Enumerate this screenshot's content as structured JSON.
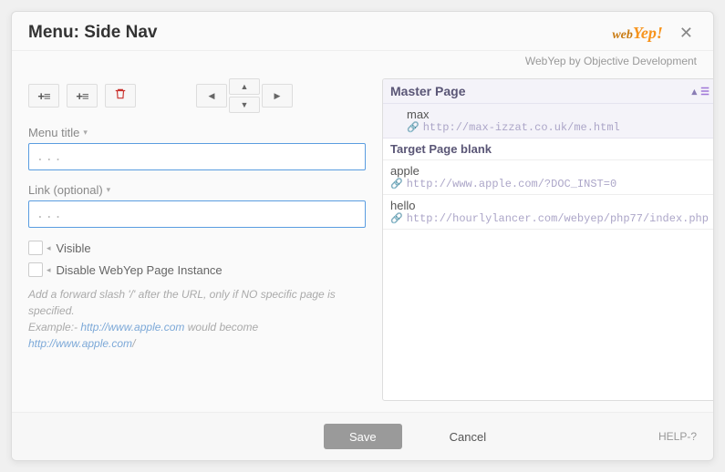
{
  "header": {
    "title": "Menu: Side Nav",
    "logo_web": "web",
    "logo_yep": "Yep!",
    "subtitle": "WebYep by Objective Development"
  },
  "toolbar": {
    "add_before_glyph": "+≡",
    "add_after_glyph": "+≡",
    "trash_glyph": "🗑",
    "arrow_left": "◀",
    "arrow_right": "▶",
    "arrow_up": "▲",
    "arrow_down": "▼"
  },
  "fields": {
    "menu_title_label": "Menu title",
    "menu_title_placeholder": "...",
    "link_label": "Link (optional)",
    "link_placeholder": "...",
    "visible_label": "Visible",
    "disable_label": "Disable WebYep Page Instance",
    "hint_pre": "Add a forward slash '/' after the URL, only if NO specific page is specified.",
    "hint_example_prefix": "Example:- ",
    "hint_url1": "http://www.apple.com",
    "hint_mid": " would become ",
    "hint_url2": "http://www.apple.com",
    "hint_slash": "/"
  },
  "tree": {
    "master_label": "Master Page",
    "items": [
      {
        "title": "max",
        "url": "http://max-izzat.co.uk/me.html",
        "indent": true
      },
      {
        "title": "Target Page blank",
        "url": "",
        "indent": false,
        "header": true
      },
      {
        "title": "apple",
        "url": "http://www.apple.com/?DOC_INST=0",
        "indent": false
      },
      {
        "title": "hello",
        "url": "http://hourlylancer.com/webyep/php77/index.php",
        "indent": false
      }
    ]
  },
  "footer": {
    "save": "Save",
    "cancel": "Cancel",
    "help": "HELP-?"
  }
}
